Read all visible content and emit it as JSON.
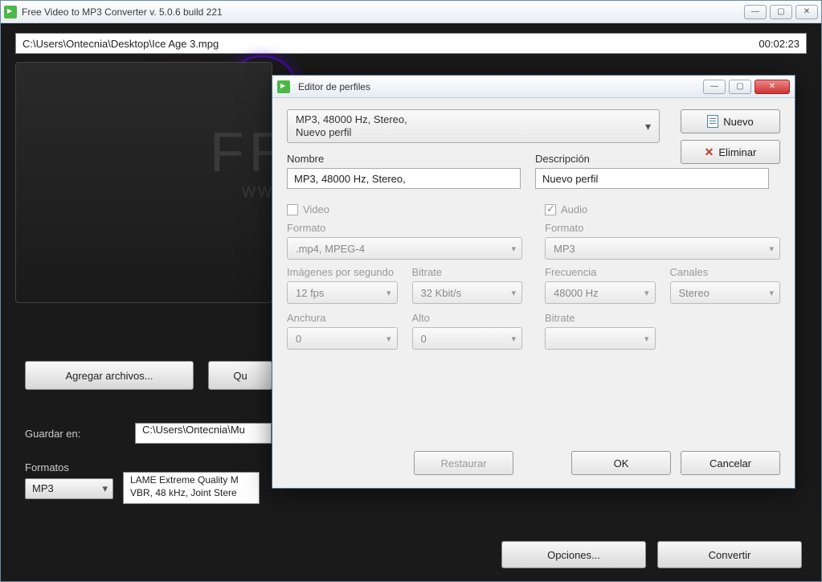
{
  "mainWindow": {
    "title": "Free Video to MP3 Converter  v. 5.0.6 build 221",
    "filePath": "C:\\Users\\Ontecnia\\Desktop\\Ice Age 3.mpg",
    "duration": "00:02:23",
    "previewBig": "FR",
    "previewSmall": "WW",
    "buttons": {
      "addFiles": "Agregar archivos...",
      "remove": "Qu"
    },
    "labels": {
      "saveIn": "Guardar en:",
      "formats": "Formatos"
    },
    "savePath": "C:\\Users\\Ontecnia\\Mu",
    "formatValue": "MP3",
    "qualityLine1": "LAME Extreme Quality M",
    "qualityLine2": "VBR, 48 kHz, Joint Stere",
    "bottom": {
      "options": "Opciones...",
      "convert": "Convertir"
    }
  },
  "dialog": {
    "title": "Editor de perfiles",
    "profileLine1": "MP3, 48000 Hz, Stereo,",
    "profileLine2": "Nuevo perfil",
    "sideButtons": {
      "new": "Nuevo",
      "delete": "Eliminar"
    },
    "labels": {
      "name": "Nombre",
      "description": "Descripción",
      "video": "Video",
      "audio": "Audio",
      "format": "Formato",
      "fps": "Imágenes por segundo",
      "bitrate": "Bitrate",
      "width": "Anchura",
      "height": "Alto",
      "frequency": "Frecuencia",
      "channels": "Canales"
    },
    "values": {
      "name": "MP3, 48000 Hz, Stereo,",
      "description": "Nuevo perfil",
      "videoFormat": ".mp4, MPEG-4",
      "fps": "12 fps",
      "videoBitrate": "32 Kbit/s",
      "width": "0",
      "height": "0",
      "audioFormat": "MP3",
      "frequency": "48000 Hz",
      "channels": "Stereo",
      "audioBitrate": ""
    },
    "footer": {
      "restore": "Restaurar",
      "ok": "OK",
      "cancel": "Cancelar"
    }
  }
}
